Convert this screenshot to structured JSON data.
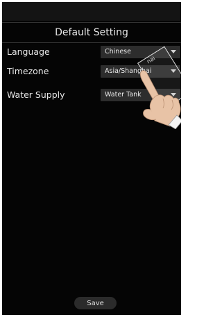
{
  "header": {
    "title": "Default Setting"
  },
  "settings": [
    {
      "label": "Language",
      "value": "Chinese"
    },
    {
      "label": "Timezone",
      "value": "Asia/Shanghai"
    },
    {
      "label": "Water Supply",
      "value": "Water Tank"
    }
  ],
  "popup_text": "nai",
  "footer": {
    "save_label": "Save"
  },
  "colors": {
    "background": "#050505",
    "field": "#2d2d2d",
    "text": "#e6e6e6"
  },
  "icons": {
    "dropdown": "chevron-down-icon",
    "gesture": "hand-pointer-icon"
  }
}
